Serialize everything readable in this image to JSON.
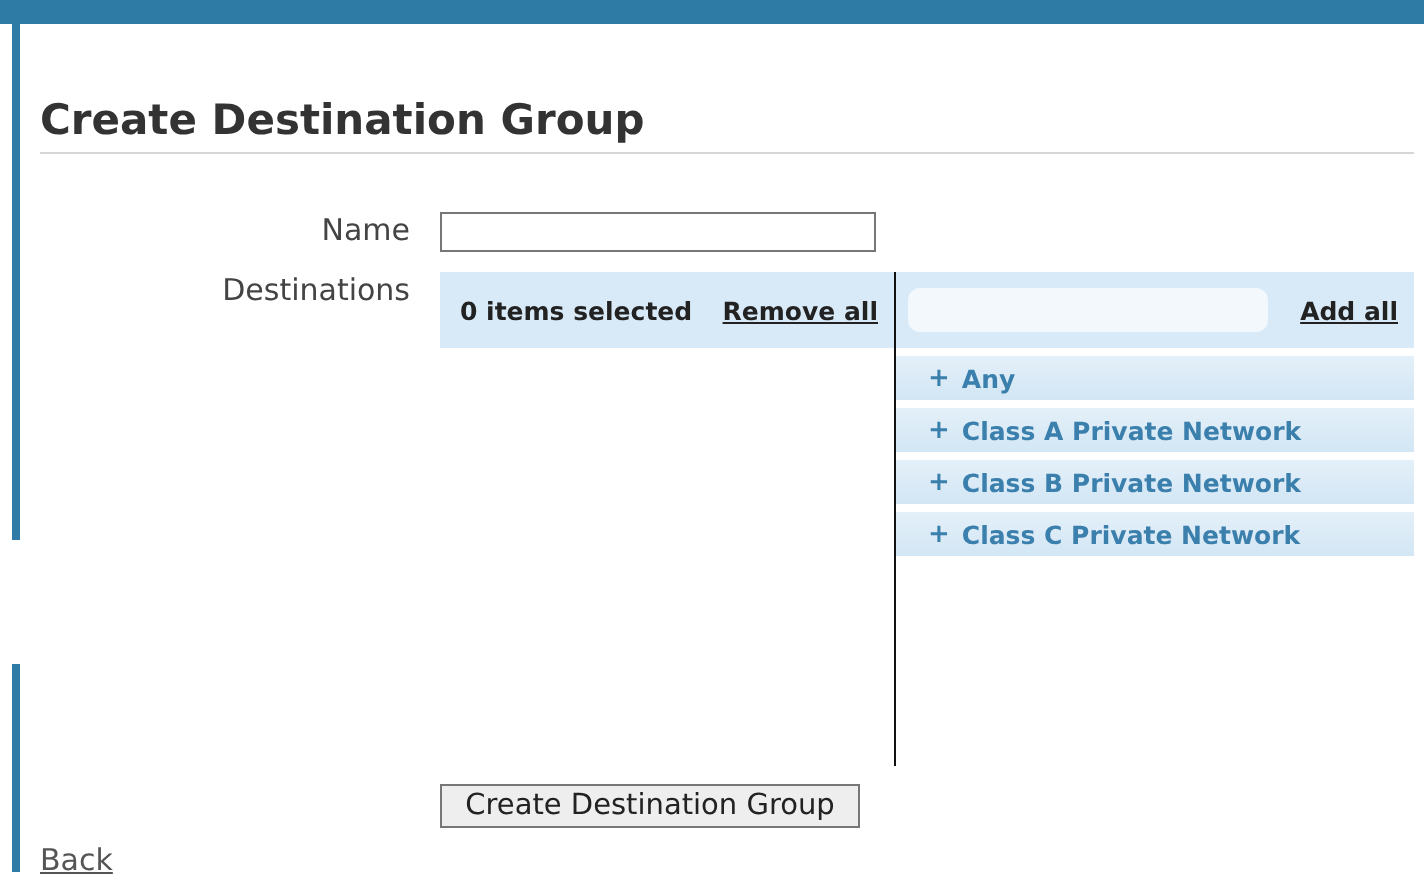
{
  "page": {
    "title": "Create Destination Group"
  },
  "form": {
    "name_label": "Name",
    "destinations_label": "Destinations"
  },
  "selected_panel": {
    "count_text": "0 items selected",
    "remove_all": "Remove all"
  },
  "available_panel": {
    "add_all": "Add all",
    "items": [
      {
        "icon": "+",
        "label": "Any"
      },
      {
        "icon": "+",
        "label": "Class A Private Network"
      },
      {
        "icon": "+",
        "label": "Class B Private Network"
      },
      {
        "icon": "+",
        "label": "Class C Private Network"
      }
    ]
  },
  "submit_button": "Create Destination Group",
  "back_link": "Back"
}
